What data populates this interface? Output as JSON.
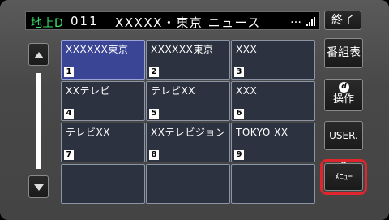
{
  "title_bar": {
    "band": "地上D",
    "channel": "011",
    "station": "XXXXX・東京 ニュース",
    "more": "…"
  },
  "buttons": {
    "exit": "終了",
    "program_guide": "番組表",
    "operation": "操作",
    "operation_icon": "d",
    "user_p": "USER. P",
    "menu": "ﾒﾆｭｰ"
  },
  "channels": [
    {
      "name": "XXXXXX東京",
      "number": "1"
    },
    {
      "name": "XXXXXX東京",
      "number": "2"
    },
    {
      "name": "XXX",
      "number": "3"
    },
    {
      "name": "XXテレビ",
      "number": "4"
    },
    {
      "name": "テレビXX",
      "number": "5"
    },
    {
      "name": "XXX",
      "number": "6"
    },
    {
      "name": "テレビXX",
      "number": "7"
    },
    {
      "name": "XXテレビジョン",
      "number": "8"
    },
    {
      "name": "TOKYO XX",
      "number": "9"
    },
    {
      "name": "",
      "number": ""
    },
    {
      "name": "",
      "number": ""
    },
    {
      "name": "",
      "number": ""
    }
  ],
  "colors": {
    "band_text": "#38e06a",
    "selected_cell": "#3b4596",
    "highlight_outline": "#e0262c"
  },
  "icons": [
    "scroll-up-arrow-icon",
    "scroll-down-arrow-icon",
    "signal-strength-icon",
    "d-button-icon"
  ]
}
